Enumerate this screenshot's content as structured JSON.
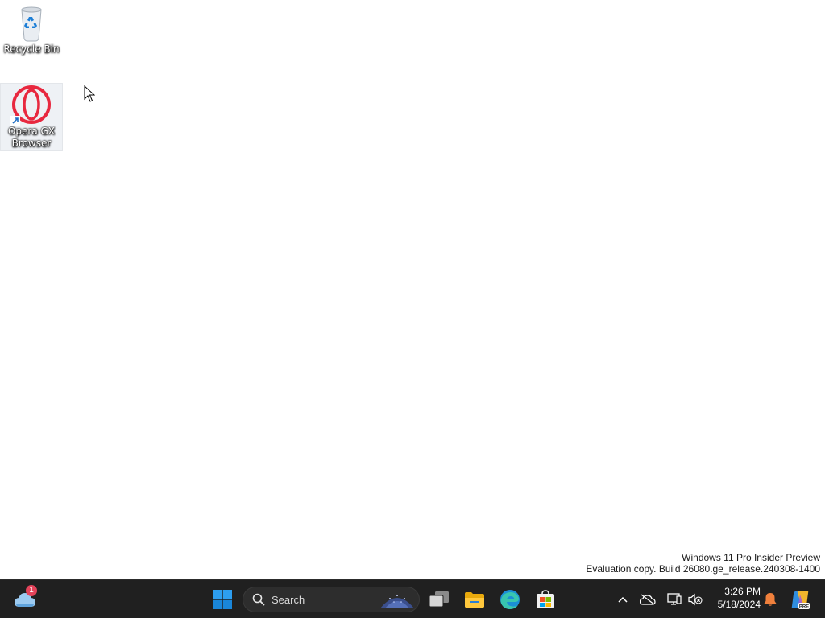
{
  "desktop": {
    "icons": [
      {
        "label": "Recycle Bin",
        "icon": "recycle-bin-icon"
      },
      {
        "label": "Opera GX Browser",
        "icon": "opera-gx-icon"
      }
    ],
    "watermark": {
      "line1": "Windows 11 Pro Insider Preview",
      "line2": "Evaluation copy. Build 26080.ge_release.240308-1400"
    }
  },
  "taskbar": {
    "widgets": {
      "icon": "weather-cloud-icon",
      "badge": "1"
    },
    "search": {
      "label": "Search"
    },
    "pinned": [
      {
        "name": "Start",
        "icon": "windows-start-icon"
      },
      {
        "name": "Task View",
        "icon": "task-view-icon"
      },
      {
        "name": "File Explorer",
        "icon": "file-explorer-icon"
      },
      {
        "name": "Microsoft Edge",
        "icon": "edge-icon"
      },
      {
        "name": "Microsoft Store",
        "icon": "store-icon"
      }
    ],
    "tray": {
      "icons": [
        "chevron-up-icon",
        "onedrive-offline-icon",
        "network-icon",
        "volume-muted-icon",
        "notification-bell-icon",
        "copilot-icon"
      ],
      "time": "3:26 PM",
      "date": "5/18/2024"
    }
  },
  "colors": {
    "taskbar_bg": "#202020",
    "desktop_bg": "#ffffff",
    "windows_blue": "#0a84d8",
    "opera_red": "#e8283f",
    "bell_orange": "#f0803c"
  }
}
